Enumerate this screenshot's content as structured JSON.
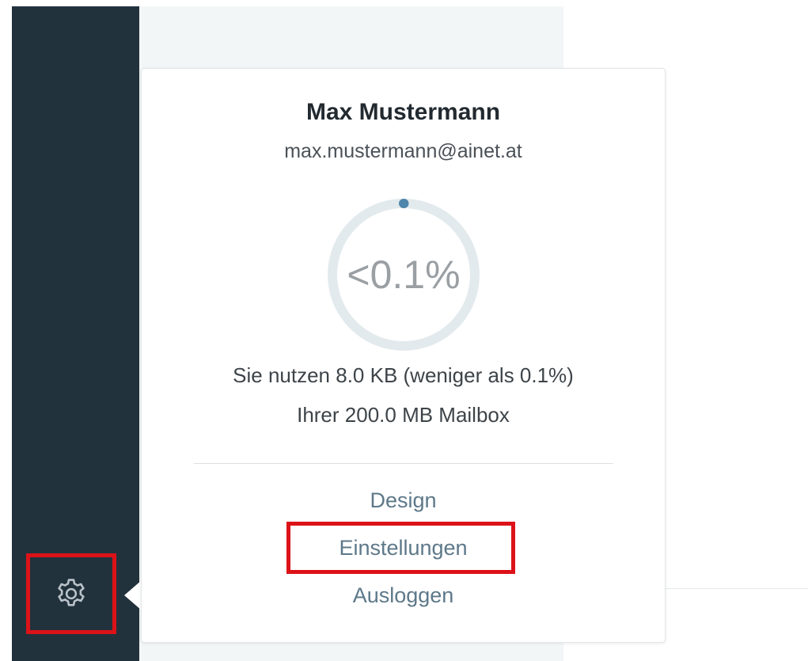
{
  "user": {
    "name": "Max Mustermann",
    "email": "max.mustermann@ainet.at"
  },
  "quota": {
    "percent_label": "<0.1%",
    "fraction_used": 0.0005,
    "usage_line1": "Sie nutzen 8.0 KB (weniger als 0.1%)",
    "usage_line2": "Ihrer 200.0 MB Mailbox"
  },
  "menu": {
    "design": "Design",
    "settings": "Einstellungen",
    "logout": "Ausloggen"
  },
  "colors": {
    "sidebar": "#22323d",
    "ring_track": "#e3eaed",
    "ring_fill": "#4f86ad",
    "link": "#5d7889",
    "highlight": "#dc1218"
  },
  "icons": {
    "sidebar_button": "gear-icon"
  }
}
